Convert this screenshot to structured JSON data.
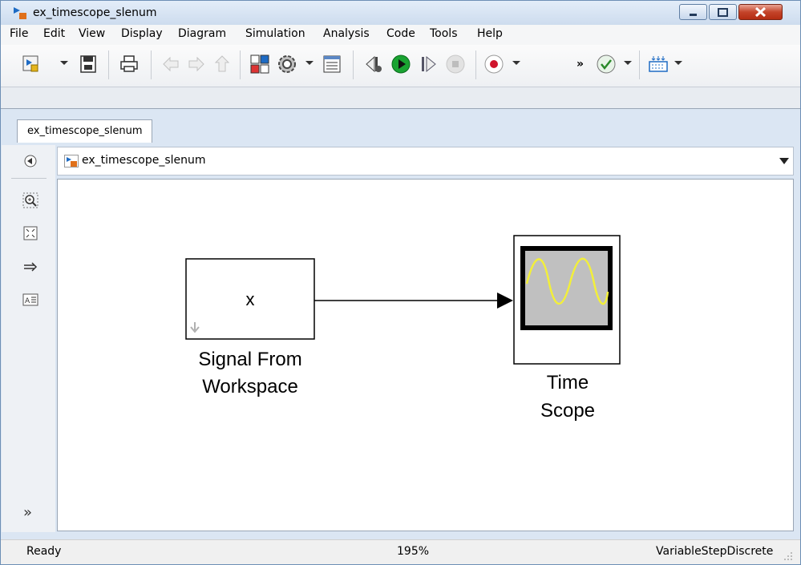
{
  "window": {
    "title": "ex_timescope_slenum"
  },
  "menu": [
    "File",
    "Edit",
    "View",
    "Display",
    "Diagram",
    "Simulation",
    "Analysis",
    "Code",
    "Tools",
    "Help"
  ],
  "tab": {
    "label": "ex_timescope_slenum"
  },
  "address": {
    "path": "ex_timescope_slenum"
  },
  "blocks": {
    "signal_from_workspace": {
      "content": "x",
      "label_line1": "Signal From",
      "label_line2": "Workspace"
    },
    "time_scope": {
      "label_line1": "Time",
      "label_line2": "Scope"
    }
  },
  "status": {
    "state": "Ready",
    "zoom": "195%",
    "solver": "VariableStepDiscrete"
  },
  "colors": {
    "scope_wave": "#f2ef3a",
    "scope_screen": "#c0c0c0",
    "record_red": "#d0142c",
    "run_green": "#1aa332"
  },
  "icons": [
    "new-model-icon",
    "save-icon",
    "print-icon",
    "back-icon",
    "forward-icon",
    "up-icon",
    "library-browser-icon",
    "settings-gear-icon",
    "model-explorer-icon",
    "step-back-icon",
    "run-icon",
    "step-forward-icon",
    "stop-icon",
    "record-icon",
    "more-icon",
    "check-icon",
    "signal-table-icon",
    "hide-browser-icon",
    "zoom-icon",
    "fit-view-icon",
    "arrow-icon",
    "annotation-icon",
    "expand-icon"
  ]
}
